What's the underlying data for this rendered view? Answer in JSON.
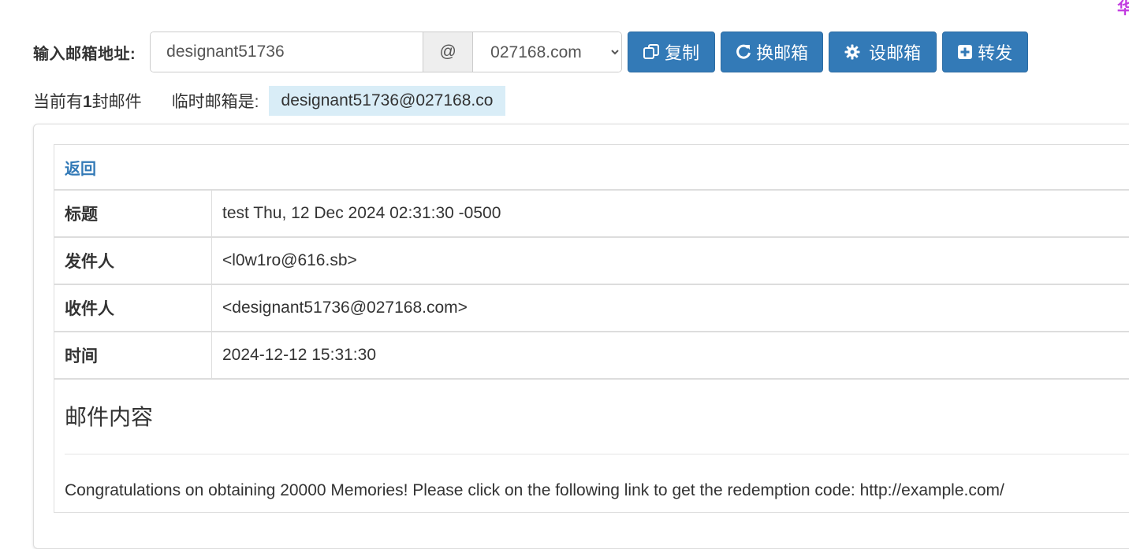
{
  "corner_glyph": "华",
  "address_bar": {
    "label": "输入邮箱地址:",
    "username_value": "designant51736",
    "at_symbol": "@",
    "domain_selected": "027168.com",
    "domain_options": [
      "027168.com"
    ]
  },
  "buttons": {
    "copy_label": "复制",
    "change_label": "换邮箱",
    "set_label": "设邮箱",
    "forward_label": "转发"
  },
  "status": {
    "count_prefix": "当前有",
    "count": "1",
    "count_suffix": "封邮件",
    "temp_label": "临时邮箱是:",
    "temp_address": "designant51736@027168.co"
  },
  "mail": {
    "back_label": "返回",
    "fields": [
      {
        "key": "标题",
        "value": "test Thu, 12 Dec 2024 02:31:30 -0500"
      },
      {
        "key": "发件人",
        "value": "<l0w1ro@616.sb>"
      },
      {
        "key": "收件人",
        "value": "<designant51736@027168.com>"
      },
      {
        "key": "时间",
        "value": "2024-12-12 15:31:30"
      }
    ],
    "content_title": "邮件内容",
    "content_body": "Congratulations on obtaining 20000 Memories! Please click on the following link to get the redemption code: http://example.com/"
  },
  "colors": {
    "primary_button": "#337ab7",
    "highlight": "#d9edf7",
    "link": "#337ab7"
  },
  "icons": {
    "copy": "copy-icon",
    "change": "refresh-icon",
    "set": "gear-icon",
    "forward": "plus-square-icon"
  }
}
